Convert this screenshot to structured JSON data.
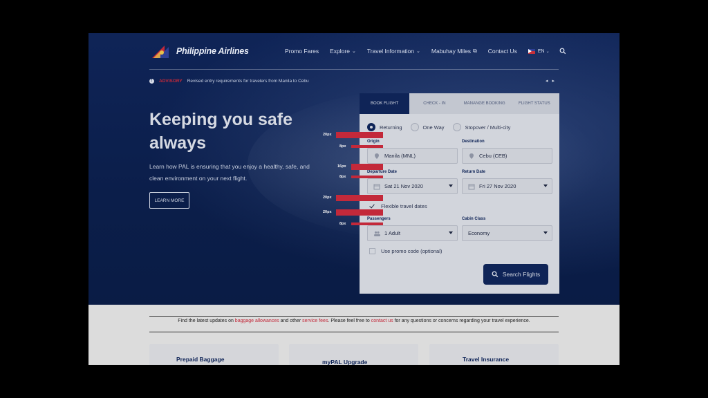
{
  "brand": {
    "name": "Philippine Airlines"
  },
  "nav": {
    "items": [
      {
        "label": "Promo Fares",
        "chevron": false,
        "external": false
      },
      {
        "label": "Explore",
        "chevron": true,
        "external": false
      },
      {
        "label": "Travel Information",
        "chevron": true,
        "external": false
      },
      {
        "label": "Mabuhay Miles",
        "chevron": false,
        "external": true
      },
      {
        "label": "Contact Us",
        "chevron": false,
        "external": false
      }
    ],
    "language": "EN",
    "search_icon": "search-icon"
  },
  "advisory": {
    "label": "ADVISORY",
    "text": "Revised entry requirements for travelers from Manila to Cebu",
    "icon": "info-icon"
  },
  "hero": {
    "title": "Keeping you safe always",
    "description": "Learn how PAL is ensuring that you enjoy a healthy, safe, and clean environment on your next flight.",
    "button": "LEARN MORE"
  },
  "booking": {
    "tabs": [
      "BOOK FLIGHT",
      "CHECK - IN",
      "MANANGE BOOKING",
      "FLIGHT STATUS"
    ],
    "active_tab": "BOOK FLIGHT",
    "trip_types": [
      {
        "label": "Returning",
        "selected": true
      },
      {
        "label": "One Way",
        "selected": false
      },
      {
        "label": "Stopover / Multi-city",
        "selected": false
      }
    ],
    "origin": {
      "label": "Origin",
      "value": "Manila (MNL)"
    },
    "destination": {
      "label": "Destination",
      "value": "Cebu (CEB)"
    },
    "departure": {
      "label": "Departure Date",
      "value": "Sat 21 Nov 2020"
    },
    "return": {
      "label": "Return Date",
      "value": "Fri 27 Nov 2020"
    },
    "flexible": {
      "label": "Flexible travel dates",
      "checked": true
    },
    "passengers": {
      "label": "Passengers",
      "value": "1 Adult"
    },
    "cabin": {
      "label": "Cabin Class",
      "value": "Economy"
    },
    "promo": {
      "label": "Use promo code (optional)",
      "checked": false
    },
    "search_button": "Search Flights"
  },
  "annotations": [
    "20px",
    "8px",
    "16px",
    "8px",
    "20px",
    "20px",
    "8px"
  ],
  "notice": {
    "part1": "Find the latest updates on ",
    "link1": "baggage allowances",
    "part2": " and other ",
    "link2": "service fees",
    "part3": ". Please feel free to ",
    "link3": "contact us",
    "part4": " for any questions or concerns regarding your travel experience."
  },
  "cards": [
    "Prepaid Baggage",
    "myPAL Upgrade",
    "Travel Insurance"
  ],
  "colors": {
    "navy": "#0f2457",
    "accent_red": "#c3293a"
  }
}
